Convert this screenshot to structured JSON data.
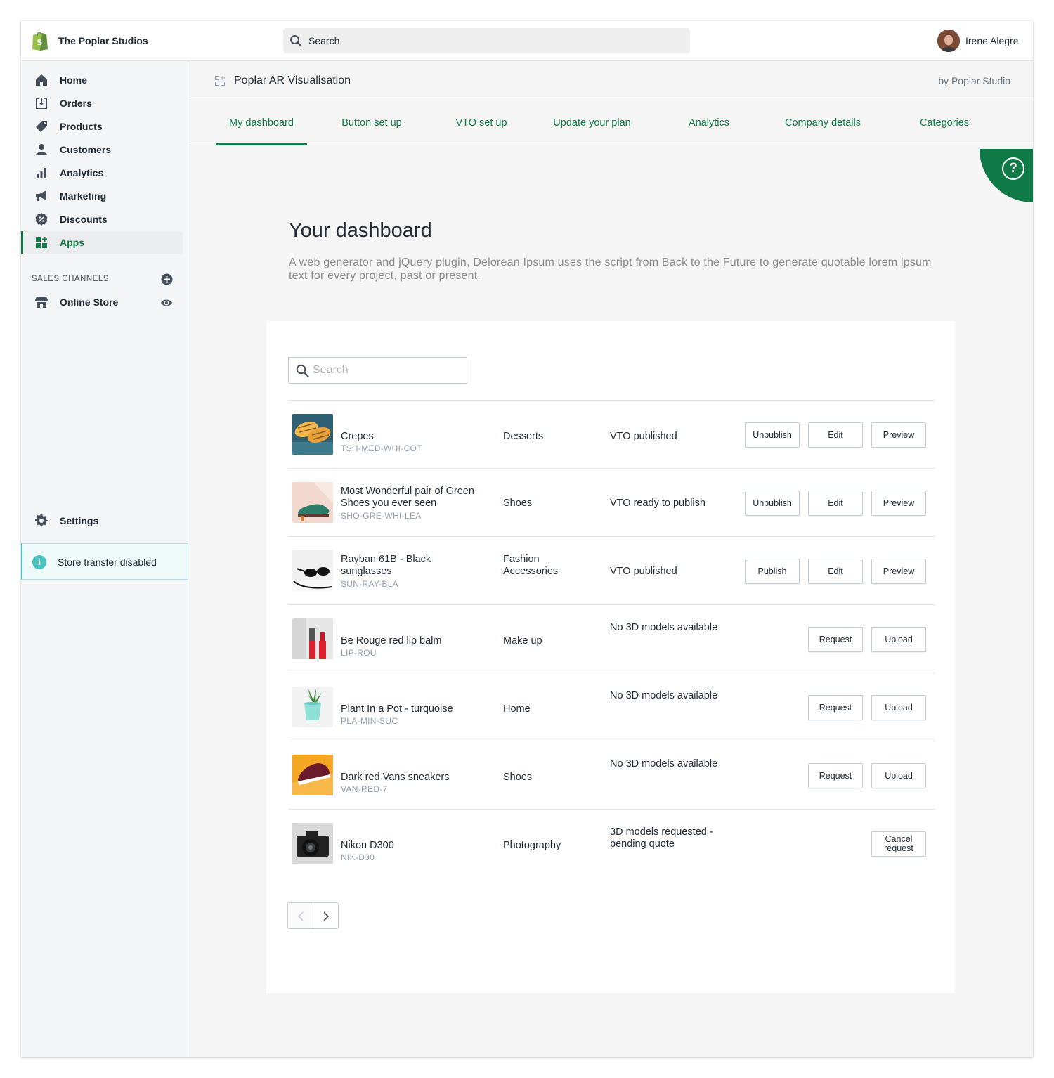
{
  "topbar": {
    "store_name": "The Poplar Studios",
    "search_label": "Search",
    "user_name": "Irene Alegre"
  },
  "sidebar": {
    "items": [
      {
        "label": "Home",
        "icon": "home-icon"
      },
      {
        "label": "Orders",
        "icon": "orders-icon"
      },
      {
        "label": "Products",
        "icon": "tag-icon"
      },
      {
        "label": "Customers",
        "icon": "person-icon"
      },
      {
        "label": "Analytics",
        "icon": "bar-chart-icon"
      },
      {
        "label": "Marketing",
        "icon": "megaphone-icon"
      },
      {
        "label": "Discounts",
        "icon": "discount-icon"
      },
      {
        "label": "Apps",
        "icon": "apps-icon",
        "active": true
      }
    ],
    "sales_channels_label": "SALES CHANNELS",
    "online_store_label": "Online Store",
    "settings_label": "Settings",
    "transfer_label": "Store transfer disabled",
    "transfer_icon_glyph": "i"
  },
  "app": {
    "title": "Poplar AR Visualisation",
    "by": "by Poplar Studio"
  },
  "tabs": [
    {
      "label": "My dashboard",
      "active": true
    },
    {
      "label": "Button set up"
    },
    {
      "label": "VTO set up"
    },
    {
      "label": "Update your plan"
    },
    {
      "label": "Analytics"
    },
    {
      "label": "Company details"
    },
    {
      "label": "Categories"
    }
  ],
  "help_glyph": "?",
  "dashboard": {
    "title": "Your dashboard",
    "description": "A web generator and jQuery plugin, Delorean Ipsum uses the script from Back to the Future to generate quotable lorem ipsum text for every project, past or present.",
    "search_placeholder": "Search"
  },
  "products": [
    {
      "name": "Crepes",
      "sku": "TSH-MED-WHI-COT",
      "category": "Desserts",
      "status": "VTO published",
      "actions": [
        "Unpublish",
        "Edit",
        "Preview"
      ],
      "thumb_colors": [
        "#f2b84b",
        "#2f5f73"
      ]
    },
    {
      "name": "Most Wonderful pair of Green Shoes you ever seen",
      "sku": "SHO-GRE-WHI-LEA",
      "category": "Shoes",
      "status": "VTO ready to publish",
      "actions": [
        "Unpublish",
        "Edit",
        "Preview"
      ],
      "thumb_colors": [
        "#f1d9cf",
        "#2e7d6a"
      ]
    },
    {
      "name": "Rayban 61B - Black sunglasses",
      "sku": "SUN-RAY-BLA",
      "category": "Fashion Accessories",
      "status": "VTO published",
      "actions": [
        "Publish",
        "Edit",
        "Preview"
      ],
      "thumb_colors": [
        "#f0f0f0",
        "#111111"
      ]
    },
    {
      "name": "Be Rouge red lip balm",
      "sku": "LIP-ROU",
      "category": "Make up",
      "status": "No 3D models available",
      "actions": [
        "Request",
        "Upload"
      ],
      "thumb_colors": [
        "#e6e6e6",
        "#d8202f"
      ]
    },
    {
      "name": "Plant In a Pot - turquoise",
      "sku": "PLA-MIN-SUC",
      "category": "Home",
      "status": "No 3D models available",
      "actions": [
        "Request",
        "Upload"
      ],
      "thumb_colors": [
        "#f2f2f2",
        "#8ee0d6"
      ]
    },
    {
      "name": "Dark red Vans sneakers",
      "sku": "VAN-RED-7",
      "category": "Shoes",
      "status": "No 3D models available",
      "actions": [
        "Request",
        "Upload"
      ],
      "thumb_colors": [
        "#f5a623",
        "#6a1b2b"
      ]
    },
    {
      "name": "Nikon D300",
      "sku": "NIK-D30",
      "category": "Photography",
      "status": "3D models requested - pending quote",
      "actions": [
        "Cancel request"
      ],
      "thumb_colors": [
        "#d9d9d9",
        "#222222"
      ]
    }
  ],
  "colors": {
    "brand_green": "#0f7a45",
    "shopify_green": "#95bf47",
    "info_teal": "#47c1bf"
  }
}
